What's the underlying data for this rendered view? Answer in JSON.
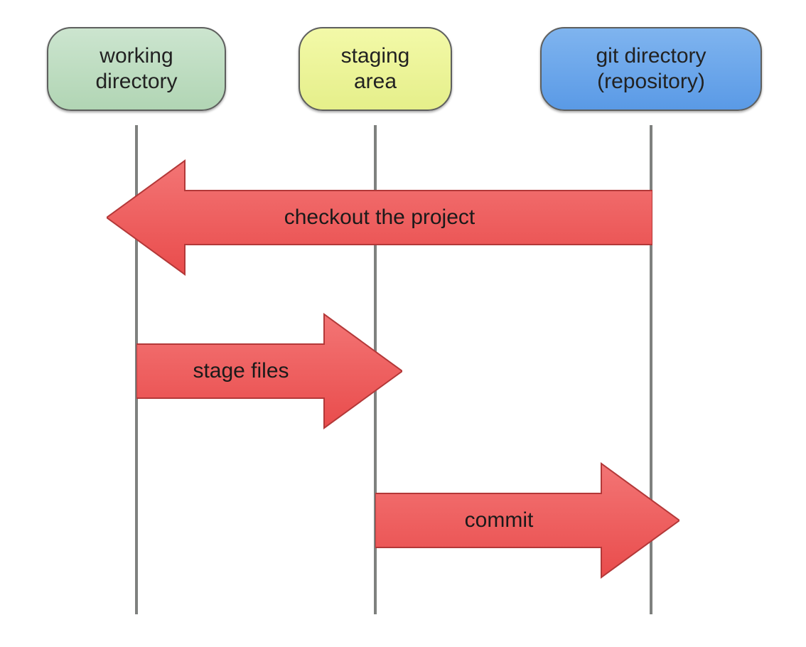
{
  "nodes": {
    "working": {
      "label": "working\ndirectory"
    },
    "staging": {
      "label": "staging\narea"
    },
    "git": {
      "label": "git directory\n(repository)"
    }
  },
  "arrows": {
    "checkout": {
      "label": "checkout the project",
      "from": "git",
      "to": "working",
      "direction": "left"
    },
    "stage": {
      "label": "stage files",
      "from": "working",
      "to": "staging",
      "direction": "right"
    },
    "commit": {
      "label": "commit",
      "from": "staging",
      "to": "git",
      "direction": "right"
    }
  },
  "colors": {
    "working_fill": "#b9d9bc",
    "staging_fill": "#ecf499",
    "git_fill": "#6aa6ea",
    "arrow_fill": "#ef5a5a",
    "arrow_stroke": "#b33838",
    "lifeline": "#7f817f"
  }
}
